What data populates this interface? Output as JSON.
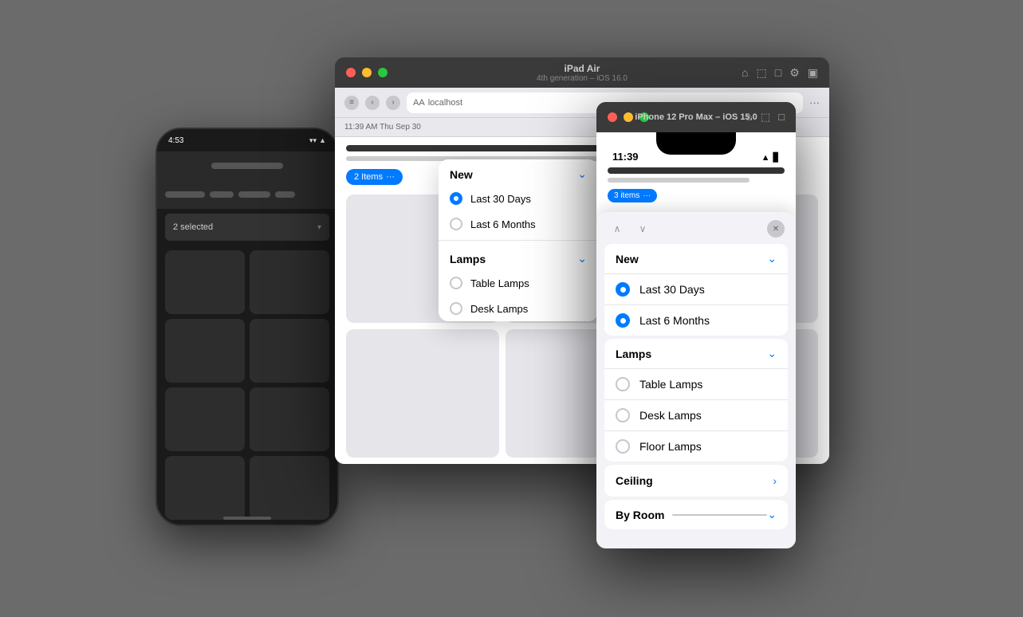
{
  "background": "#6b6b6b",
  "android": {
    "status_time": "4:53",
    "selector_text": "2 selected",
    "grid_count": 8
  },
  "mac_window": {
    "title": "iPad Air",
    "subtitle": "4th generation – iOS 16.0",
    "address": "localhost",
    "aa_label": "AA",
    "status_time": "11:39 AM  Thu Sep 30",
    "filter_chip": "2 Items",
    "toolbar_dots": "···",
    "dropdown": {
      "section1_title": "New",
      "item1": "Last 30 Days",
      "item2": "Last 6 Months",
      "section2_title": "Lamps",
      "item3": "Table Lamps",
      "item4": "Desk Lamps"
    }
  },
  "iphone_window": {
    "title": "iPhone 12 Pro Max – iOS 15.0",
    "status_time": "11:39",
    "filter_chip": "3 items",
    "filter_chip_dots": "···",
    "panel": {
      "section1_title": "New",
      "item1": "Last 30 Days",
      "item2": "Last 6 Months",
      "section2_title": "Lamps",
      "item3": "Table Lamps",
      "item4": "Desk Lamps",
      "item5": "Floor Lamps",
      "section3_title": "Ceiling",
      "section4_title": "By Room"
    }
  }
}
